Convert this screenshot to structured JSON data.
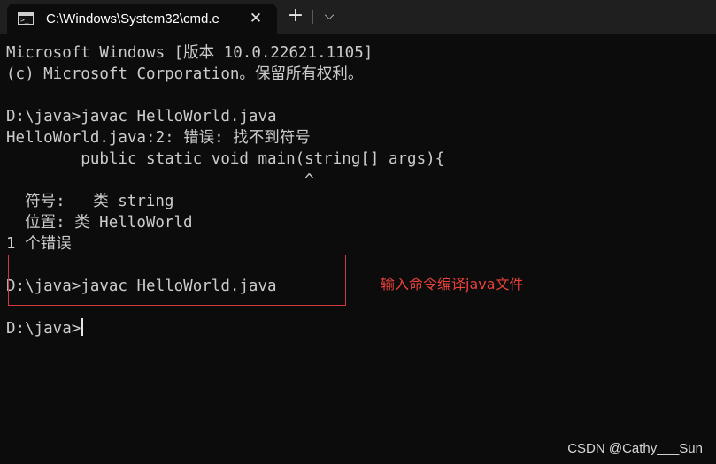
{
  "tab": {
    "title": "C:\\Windows\\System32\\cmd.e",
    "icon": "terminal-icon",
    "close_glyph": "✕",
    "add_glyph": "+",
    "dropdown_glyph": "⌵"
  },
  "terminal": {
    "lines": [
      "Microsoft Windows [版本 10.0.22621.1105]",
      "(c) Microsoft Corporation。保留所有权利。",
      "",
      "D:\\java>javac HelloWorld.java",
      "HelloWorld.java:2: 错误: 找不到符号",
      "        public static void main(string[] args){",
      "                                ^",
      "  符号:   类 string",
      "  位置: 类 HelloWorld",
      "1 个错误",
      "",
      "D:\\java>javac HelloWorld.java",
      "",
      "D:\\java>"
    ]
  },
  "annotation": {
    "text": "输入命令编译java文件",
    "color": "#e8423a"
  },
  "watermark": "CSDN @Cathy___Sun",
  "colors": {
    "background": "#0c0c0c",
    "tabbar": "#1f1f1f",
    "text": "#cccccc"
  }
}
